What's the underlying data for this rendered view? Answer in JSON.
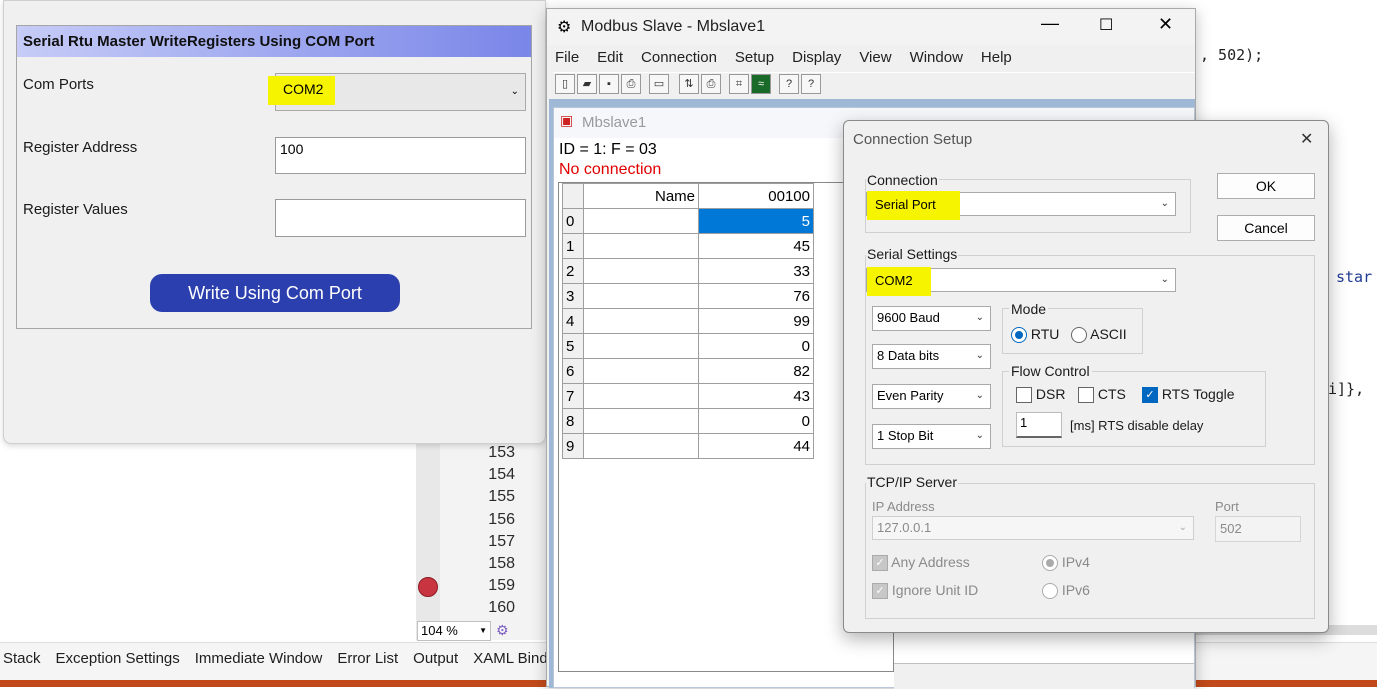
{
  "ide": {
    "code_right_1": ", 502);",
    "code_right_2": "star",
    "code_right_3": "i]},",
    "line_numbers": [
      "153",
      "154",
      "155",
      "156",
      "157",
      "158",
      "159",
      "160"
    ],
    "zoom": "104 %",
    "bottom_tabs": [
      "Stack",
      "Exception Settings",
      "Immediate Window",
      "Error List",
      "Output",
      "XAML Bindi"
    ]
  },
  "form": {
    "title": "Serial Rtu Master WriteRegisters Using COM Port",
    "com_ports_label": "Com Ports",
    "com_ports_value": "COM2",
    "register_address_label": "Register Address",
    "register_address_value": "100",
    "register_values_label": "Register Values",
    "register_values_value": "",
    "write_button": "Write Using Com Port"
  },
  "modbus": {
    "title": "Modbus Slave - Mbslave1",
    "menu": [
      "File",
      "Edit",
      "Connection",
      "Setup",
      "Display",
      "View",
      "Window",
      "Help"
    ],
    "child_title": "Mbslave1",
    "status_line": "ID = 1: F = 03",
    "error_line": "No connection",
    "colors": {
      "error": "#e00000",
      "selection": "#0078d7"
    },
    "grid": {
      "headers": [
        "Name",
        "00100"
      ],
      "rows": [
        {
          "idx": "0",
          "value": "5"
        },
        {
          "idx": "1",
          "value": "45"
        },
        {
          "idx": "2",
          "value": "33"
        },
        {
          "idx": "3",
          "value": "76"
        },
        {
          "idx": "4",
          "value": "99"
        },
        {
          "idx": "5",
          "value": "0"
        },
        {
          "idx": "6",
          "value": "82"
        },
        {
          "idx": "7",
          "value": "43"
        },
        {
          "idx": "8",
          "value": "0"
        },
        {
          "idx": "9",
          "value": "44"
        }
      ]
    }
  },
  "dialog": {
    "title": "Connection Setup",
    "connection_label": "Connection",
    "connection_value": "Serial Port",
    "ok": "OK",
    "cancel": "Cancel",
    "serial_settings_label": "Serial Settings",
    "port_value": "COM2",
    "baud": "9600 Baud",
    "data_bits": "8 Data bits",
    "parity": "Even Parity",
    "stop_bits": "1 Stop Bit",
    "mode_label": "Mode",
    "mode_rtu": "RTU",
    "mode_ascii": "ASCII",
    "flow_label": "Flow Control",
    "dsr": "DSR",
    "cts": "CTS",
    "rts_toggle": "RTS Toggle",
    "rts_delay_value": "1",
    "rts_delay_label": "[ms] RTS disable delay",
    "tcp_label": "TCP/IP Server",
    "ip_label": "IP Address",
    "ip_value": "127.0.0.1",
    "port_label": "Port",
    "port_num": "502",
    "any_address": "Any Address",
    "ignore_unit": "Ignore Unit ID",
    "ipv4": "IPv4",
    "ipv6": "IPv6"
  }
}
